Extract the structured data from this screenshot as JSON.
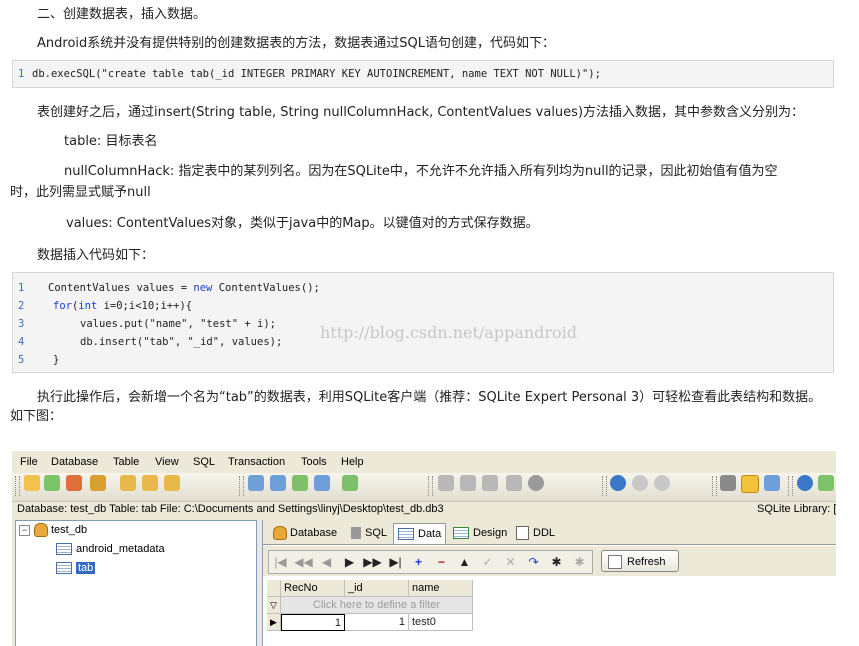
{
  "heading": "二、创建数据表，插入数据。",
  "para1": "Android系统并没有提供特别的创建数据表的方法，数据表通过SQL语句创建，代码如下：",
  "code1": {
    "line_no": "1",
    "text": "db.execSQL(\"create table tab(_id INTEGER PRIMARY KEY AUTOINCREMENT, name TEXT NOT NULL)\");"
  },
  "para2": "表创建好之后，通过insert(String table, String nullColumnHack, ContentValues values)方法插入数据，其中参数含义分别为：",
  "param_table": "table: 目标表名",
  "param_null_1": "nullColumnHack: 指定表中的某列列名。因为在SQLite中，不允许不允许插入所有列均为null的记录，因此初始值有值为空",
  "param_null_2": "时，此列需显式赋予null",
  "param_values": "values: ContentValues对象，类似于java中的Map。以键值对的方式保存数据。",
  "para3": "数据插入代码如下：",
  "code2": {
    "line_numbers": [
      "1",
      "2",
      "3",
      "4",
      "5"
    ],
    "l1_a": "ContentValues values = ",
    "l1_kw": "new",
    "l1_b": " ContentValues();",
    "l2_kw": "for",
    "l2_a": "(",
    "l2_kw2": "int",
    "l2_b": " i=0;i<10;i++){",
    "l3": "values.put(\"name\", \"test\" + i);",
    "l4": "db.insert(\"tab\", \"_id\", values);",
    "l5": "}"
  },
  "watermark": "http://blog.csdn.net/appandroid",
  "para4_1": "执行此操作后，会新增一个名为“tab”的数据表，利用SQLite客户端（推荐：SQLite Expert Personal 3）可轻松查看此表结构和数据。",
  "para4_2": "如下图：",
  "app": {
    "menus": [
      "File",
      "Database",
      "Table",
      "View",
      "SQL",
      "Transaction",
      "Tools",
      "Help"
    ],
    "status": "Database: test_db   Table: tab   File: C:\\Documents and Settings\\linyj\\Desktop\\test_db.db3",
    "library": "SQLite Library: [i",
    "tree": {
      "root": "test_db",
      "items": [
        "android_metadata",
        "tab"
      ]
    },
    "tabs": [
      "Database",
      "SQL",
      "Data",
      "Design",
      "DDL"
    ],
    "nav_glyphs": [
      "|◀",
      "◀◀",
      "◀",
      "▶",
      "▶▶",
      "▶|",
      "+",
      "−",
      "▲",
      "✓",
      "✕",
      "↷",
      "✱",
      "✱"
    ],
    "refresh": "Refresh",
    "grid": {
      "columns": [
        "RecNo",
        "_id",
        "name"
      ],
      "filter": "Click here to define a filter",
      "rows": [
        {
          "recno": "1",
          "id": "1",
          "name": "test0"
        }
      ]
    },
    "colors": {
      "accent": "#316ac5",
      "toolbar": "#ece9d8"
    }
  }
}
